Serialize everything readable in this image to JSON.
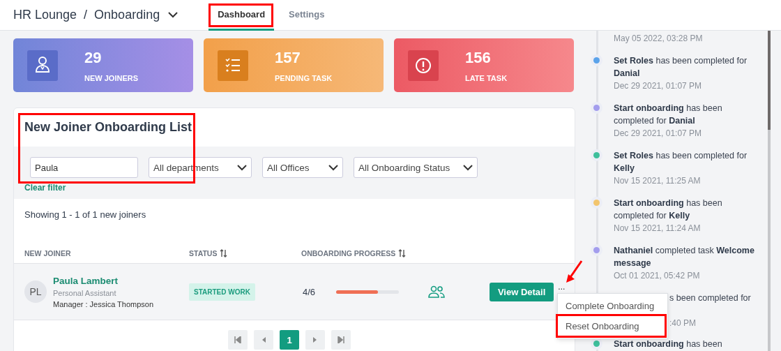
{
  "breadcrumb": {
    "app": "HR Lounge",
    "separator": "/",
    "module": "Onboarding"
  },
  "tabs": [
    {
      "label": "Dashboard",
      "selected": true
    },
    {
      "label": "Settings",
      "selected": false
    }
  ],
  "stats": [
    {
      "kind": "joiners",
      "value": "29",
      "label": "NEW JOINERS"
    },
    {
      "kind": "pending",
      "value": "157",
      "label": "PENDING TASK"
    },
    {
      "kind": "late",
      "value": "156",
      "label": "LATE TASK"
    }
  ],
  "list": {
    "title": "New Joiner Onboarding List",
    "filters": {
      "search": "Paula",
      "selects": [
        "All departments",
        "All Offices",
        "All Onboarding Status"
      ],
      "clear": "Clear filter"
    },
    "summary": "Showing 1 - 1 of 1 new joiners",
    "columns": [
      {
        "label": "NEW JOINER",
        "sortable": false
      },
      {
        "label": "STATUS",
        "sortable": true
      },
      {
        "label": "ONBOARDING PROGRESS",
        "sortable": true
      }
    ],
    "rows": [
      {
        "initials": "PL",
        "name": "Paula Lambert",
        "role": "Personal Assistant",
        "manager": "Manager : Jessica Thompson",
        "status": "STARTED WORK",
        "progress_text": "4/6",
        "level": 0.67,
        "action": "View Detail",
        "more": "..."
      }
    ],
    "pagination": {
      "pages": [
        {
          "label": "1",
          "selected": true
        }
      ]
    }
  },
  "row_menu": {
    "items": [
      "Complete Onboarding",
      "Reset Onboarding"
    ]
  },
  "timeline": [
    {
      "kind": "full",
      "date": "May 05 2022, 03:28 PM"
    },
    {
      "kind": "full",
      "color": "#5ba3ea",
      "text": "**Set Roles** has been completed for **Danial**",
      "date": "Dec 29 2021, 01:07 PM"
    },
    {
      "kind": "full",
      "color": "#a39ded",
      "text": "**Start onboarding** has been completed for **Danial**",
      "date": "Dec 29 2021, 01:07 PM"
    },
    {
      "kind": "full",
      "color": "#3dbf9c",
      "text": "**Set Roles** has been completed for **Kelly**",
      "date": "Nov 15 2021, 11:25 AM"
    },
    {
      "kind": "full",
      "color": "#f2c56e",
      "text": "**Start onboarding** has been completed for **Kelly**",
      "date": "Nov 15 2021, 11:24 AM"
    },
    {
      "kind": "full",
      "color": "#a39ded",
      "text": "**Nathaniel** completed task **Welcome message**",
      "date": "Oct 01 2021, 05:42 PM"
    },
    {
      "kind": "covered",
      "text": "s been completed for",
      "date": ":40 PM"
    },
    {
      "kind": "full",
      "color": "#3dbf9c",
      "text": "**Start onboarding** has been"
    }
  ]
}
